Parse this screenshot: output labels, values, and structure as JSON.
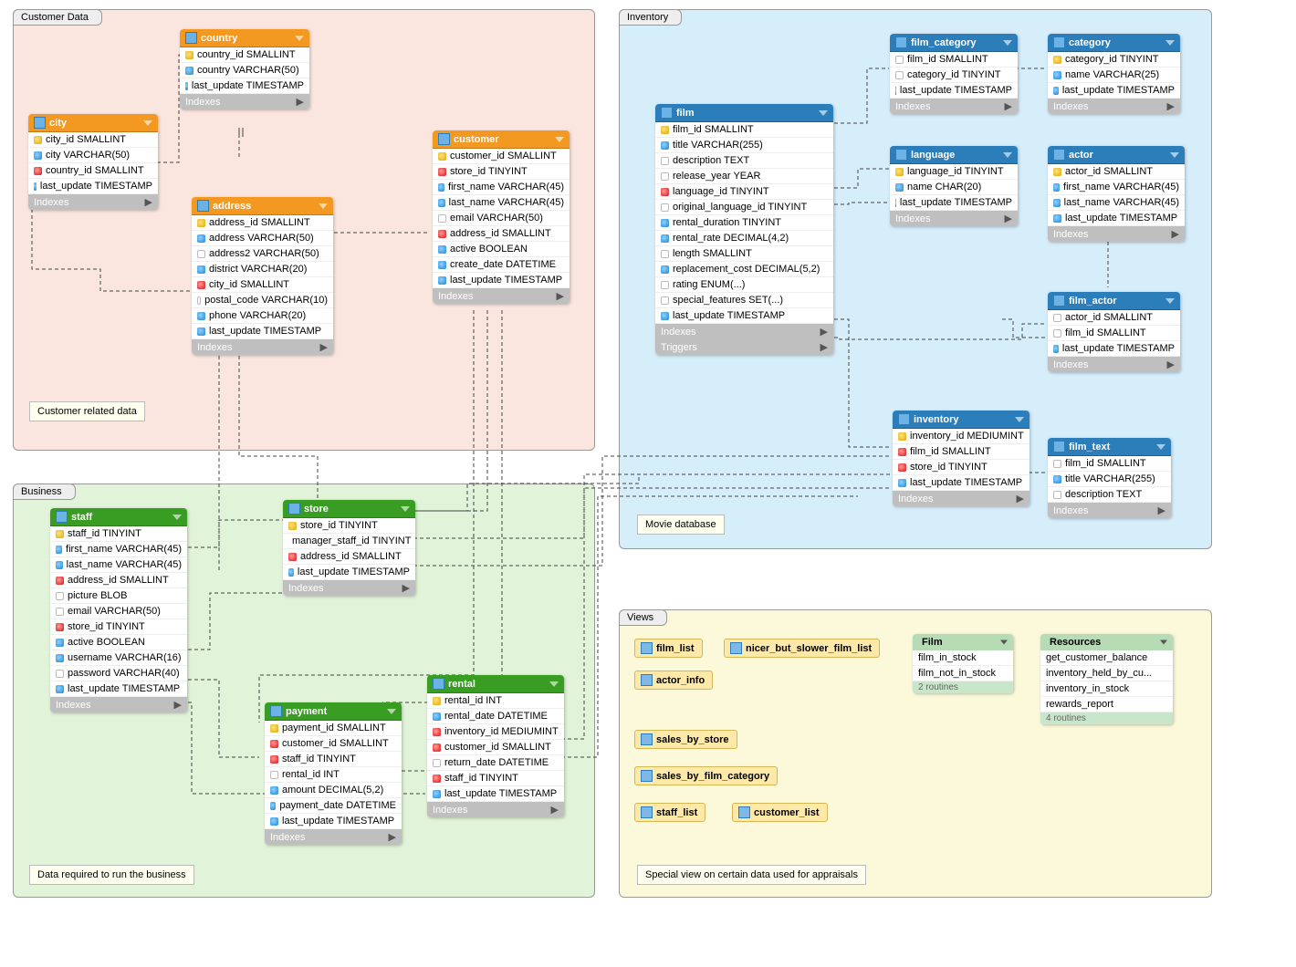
{
  "regions": {
    "customer": {
      "label": "Customer Data",
      "caption": "Customer related data"
    },
    "business": {
      "label": "Business",
      "caption": "Data required to run the business"
    },
    "inventory": {
      "label": "Inventory",
      "caption": "Movie database"
    },
    "views": {
      "label": "Views",
      "caption": "Special view on certain data used for appraisals"
    }
  },
  "footers": {
    "indexes": "Indexes",
    "triggers": "Triggers"
  },
  "tables": {
    "country": {
      "title": "country",
      "cols": [
        {
          "icon": "key",
          "txt": "country_id SMALLINT"
        },
        {
          "icon": "blue",
          "txt": "country VARCHAR(50)"
        },
        {
          "icon": "blue",
          "txt": "last_update TIMESTAMP"
        }
      ]
    },
    "city": {
      "title": "city",
      "cols": [
        {
          "icon": "key",
          "txt": "city_id SMALLINT"
        },
        {
          "icon": "blue",
          "txt": "city VARCHAR(50)"
        },
        {
          "icon": "red",
          "txt": "country_id SMALLINT"
        },
        {
          "icon": "blue",
          "txt": "last_update TIMESTAMP"
        }
      ]
    },
    "address": {
      "title": "address",
      "cols": [
        {
          "icon": "key",
          "txt": "address_id SMALLINT"
        },
        {
          "icon": "blue",
          "txt": "address VARCHAR(50)"
        },
        {
          "icon": "none",
          "txt": "address2 VARCHAR(50)"
        },
        {
          "icon": "blue",
          "txt": "district VARCHAR(20)"
        },
        {
          "icon": "red",
          "txt": "city_id SMALLINT"
        },
        {
          "icon": "none",
          "txt": "postal_code VARCHAR(10)"
        },
        {
          "icon": "blue",
          "txt": "phone VARCHAR(20)"
        },
        {
          "icon": "blue",
          "txt": "last_update TIMESTAMP"
        }
      ]
    },
    "customer": {
      "title": "customer",
      "cols": [
        {
          "icon": "key",
          "txt": "customer_id SMALLINT"
        },
        {
          "icon": "red",
          "txt": "store_id TINYINT"
        },
        {
          "icon": "blue",
          "txt": "first_name VARCHAR(45)"
        },
        {
          "icon": "blue",
          "txt": "last_name VARCHAR(45)"
        },
        {
          "icon": "none",
          "txt": "email VARCHAR(50)"
        },
        {
          "icon": "red",
          "txt": "address_id SMALLINT"
        },
        {
          "icon": "blue",
          "txt": "active BOOLEAN"
        },
        {
          "icon": "blue",
          "txt": "create_date DATETIME"
        },
        {
          "icon": "blue",
          "txt": "last_update TIMESTAMP"
        }
      ]
    },
    "staff": {
      "title": "staff",
      "cols": [
        {
          "icon": "key",
          "txt": "staff_id TINYINT"
        },
        {
          "icon": "blue",
          "txt": "first_name VARCHAR(45)"
        },
        {
          "icon": "blue",
          "txt": "last_name VARCHAR(45)"
        },
        {
          "icon": "red",
          "txt": "address_id SMALLINT"
        },
        {
          "icon": "none",
          "txt": "picture BLOB"
        },
        {
          "icon": "none",
          "txt": "email VARCHAR(50)"
        },
        {
          "icon": "red",
          "txt": "store_id TINYINT"
        },
        {
          "icon": "blue",
          "txt": "active BOOLEAN"
        },
        {
          "icon": "blue",
          "txt": "username VARCHAR(16)"
        },
        {
          "icon": "none",
          "txt": "password VARCHAR(40)"
        },
        {
          "icon": "blue",
          "txt": "last_update TIMESTAMP"
        }
      ]
    },
    "store": {
      "title": "store",
      "cols": [
        {
          "icon": "key",
          "txt": "store_id TINYINT"
        },
        {
          "icon": "red",
          "txt": "manager_staff_id TINYINT"
        },
        {
          "icon": "red",
          "txt": "address_id SMALLINT"
        },
        {
          "icon": "blue",
          "txt": "last_update TIMESTAMP"
        }
      ]
    },
    "payment": {
      "title": "payment",
      "cols": [
        {
          "icon": "key",
          "txt": "payment_id SMALLINT"
        },
        {
          "icon": "red",
          "txt": "customer_id SMALLINT"
        },
        {
          "icon": "red",
          "txt": "staff_id TINYINT"
        },
        {
          "icon": "none",
          "txt": "rental_id INT"
        },
        {
          "icon": "blue",
          "txt": "amount DECIMAL(5,2)"
        },
        {
          "icon": "blue",
          "txt": "payment_date DATETIME"
        },
        {
          "icon": "blue",
          "txt": "last_update TIMESTAMP"
        }
      ]
    },
    "rental": {
      "title": "rental",
      "cols": [
        {
          "icon": "key",
          "txt": "rental_id INT"
        },
        {
          "icon": "blue",
          "txt": "rental_date DATETIME"
        },
        {
          "icon": "red",
          "txt": "inventory_id MEDIUMINT"
        },
        {
          "icon": "red",
          "txt": "customer_id SMALLINT"
        },
        {
          "icon": "none",
          "txt": "return_date DATETIME"
        },
        {
          "icon": "red",
          "txt": "staff_id TINYINT"
        },
        {
          "icon": "blue",
          "txt": "last_update TIMESTAMP"
        }
      ]
    },
    "film": {
      "title": "film",
      "cols": [
        {
          "icon": "key",
          "txt": "film_id SMALLINT"
        },
        {
          "icon": "blue",
          "txt": "title VARCHAR(255)"
        },
        {
          "icon": "none",
          "txt": "description TEXT"
        },
        {
          "icon": "none",
          "txt": "release_year YEAR"
        },
        {
          "icon": "red",
          "txt": "language_id TINYINT"
        },
        {
          "icon": "none",
          "txt": "original_language_id TINYINT"
        },
        {
          "icon": "blue",
          "txt": "rental_duration TINYINT"
        },
        {
          "icon": "blue",
          "txt": "rental_rate DECIMAL(4,2)"
        },
        {
          "icon": "none",
          "txt": "length SMALLINT"
        },
        {
          "icon": "blue",
          "txt": "replacement_cost DECIMAL(5,2)"
        },
        {
          "icon": "none",
          "txt": "rating ENUM(...)"
        },
        {
          "icon": "none",
          "txt": "special_features SET(...)"
        },
        {
          "icon": "blue",
          "txt": "last_update TIMESTAMP"
        }
      ]
    },
    "film_category": {
      "title": "film_category",
      "cols": [
        {
          "icon": "none",
          "txt": "film_id SMALLINT"
        },
        {
          "icon": "none",
          "txt": "category_id TINYINT"
        },
        {
          "icon": "blue",
          "txt": "last_update TIMESTAMP"
        }
      ]
    },
    "category": {
      "title": "category",
      "cols": [
        {
          "icon": "key",
          "txt": "category_id TINYINT"
        },
        {
          "icon": "blue",
          "txt": "name VARCHAR(25)"
        },
        {
          "icon": "blue",
          "txt": "last_update TIMESTAMP"
        }
      ]
    },
    "language": {
      "title": "language",
      "cols": [
        {
          "icon": "key",
          "txt": "language_id TINYINT"
        },
        {
          "icon": "blue",
          "txt": "name CHAR(20)"
        },
        {
          "icon": "blue",
          "txt": "last_update TIMESTAMP"
        }
      ]
    },
    "actor": {
      "title": "actor",
      "cols": [
        {
          "icon": "key",
          "txt": "actor_id SMALLINT"
        },
        {
          "icon": "blue",
          "txt": "first_name VARCHAR(45)"
        },
        {
          "icon": "blue",
          "txt": "last_name VARCHAR(45)"
        },
        {
          "icon": "blue",
          "txt": "last_update TIMESTAMP"
        }
      ]
    },
    "film_actor": {
      "title": "film_actor",
      "cols": [
        {
          "icon": "none",
          "txt": "actor_id SMALLINT"
        },
        {
          "icon": "none",
          "txt": "film_id SMALLINT"
        },
        {
          "icon": "blue",
          "txt": "last_update TIMESTAMP"
        }
      ]
    },
    "inventory": {
      "title": "inventory",
      "cols": [
        {
          "icon": "key",
          "txt": "inventory_id MEDIUMINT"
        },
        {
          "icon": "red",
          "txt": "film_id SMALLINT"
        },
        {
          "icon": "red",
          "txt": "store_id TINYINT"
        },
        {
          "icon": "blue",
          "txt": "last_update TIMESTAMP"
        }
      ]
    },
    "film_text": {
      "title": "film_text",
      "cols": [
        {
          "icon": "none",
          "txt": "film_id SMALLINT"
        },
        {
          "icon": "blue",
          "txt": "title VARCHAR(255)"
        },
        {
          "icon": "none",
          "txt": "description TEXT"
        }
      ]
    }
  },
  "views": {
    "film_list": "film_list",
    "nicer": "nicer_but_slower_film_list",
    "actor_info": "actor_info",
    "sales_store": "sales_by_store",
    "sales_cat": "sales_by_film_category",
    "staff_list": "staff_list",
    "cust_list": "customer_list"
  },
  "routine_boxes": {
    "film": {
      "title": "Film",
      "items": [
        "film_in_stock",
        "film_not_in_stock"
      ],
      "footer": "2 routines"
    },
    "resources": {
      "title": "Resources",
      "items": [
        "get_customer_balance",
        "inventory_held_by_cu...",
        "inventory_in_stock",
        "rewards_report"
      ],
      "footer": "4 routines"
    }
  }
}
